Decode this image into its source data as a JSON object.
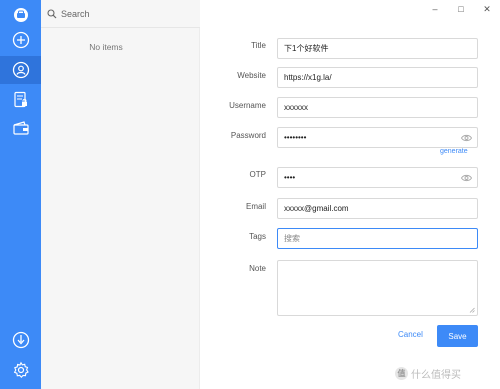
{
  "search": {
    "placeholder": "Search"
  },
  "list": {
    "empty_text": "No items"
  },
  "window_controls": {
    "minimize": "–",
    "maximize": "□",
    "close": "✕"
  },
  "form": {
    "title": {
      "label": "Title",
      "value": "下1个好软件"
    },
    "website": {
      "label": "Website",
      "value": "https://x1g.la/"
    },
    "username": {
      "label": "Username",
      "value": "xxxxxx"
    },
    "password": {
      "label": "Password",
      "value": "••••••••",
      "generate_label": "generate"
    },
    "otp": {
      "label": "OTP",
      "value": "••••"
    },
    "email": {
      "label": "Email",
      "value": "xxxxx@gmail.com"
    },
    "tags": {
      "label": "Tags",
      "value": "搜索"
    },
    "note": {
      "label": "Note",
      "value": ""
    },
    "cancel_label": "Cancel",
    "save_label": "Save"
  },
  "watermark": {
    "text": "什么值得买",
    "badge": "值"
  },
  "colors": {
    "accent": "#3d8af7",
    "rail_active": "#2f74dc",
    "list_bg": "#f6f6f6"
  },
  "icons": {
    "rail": [
      "app-logo-icon",
      "add-icon",
      "account-icon",
      "document-lock-icon",
      "wallet-icon",
      "sync-icon",
      "settings-icon"
    ],
    "search": "search-icon",
    "tag": "tag-icon",
    "eye": "eye-icon"
  }
}
